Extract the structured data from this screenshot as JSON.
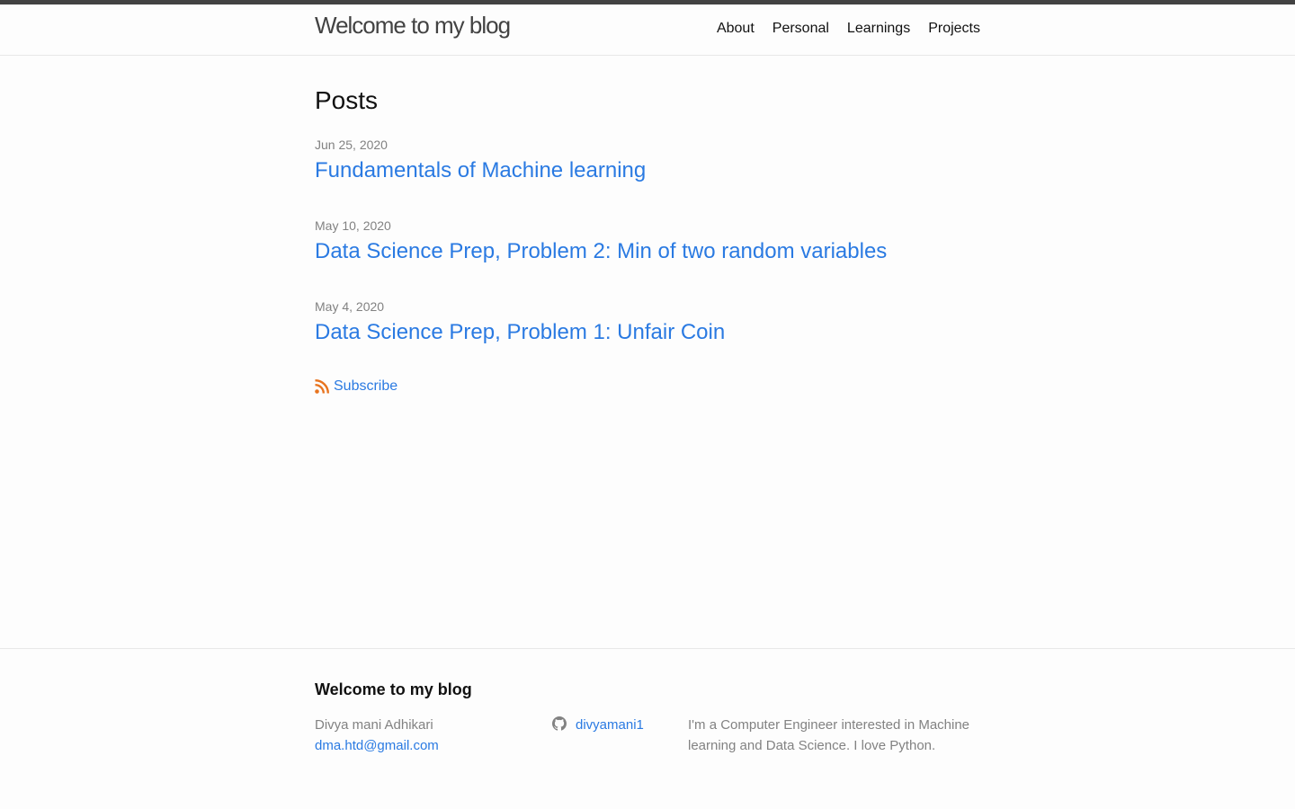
{
  "header": {
    "site_title": "Welcome to my blog",
    "nav": [
      {
        "label": "About"
      },
      {
        "label": "Personal"
      },
      {
        "label": "Learnings"
      },
      {
        "label": "Projects"
      }
    ]
  },
  "main": {
    "heading": "Posts",
    "posts": [
      {
        "date": "Jun 25, 2020",
        "title": "Fundamentals of Machine learning"
      },
      {
        "date": "May 10, 2020",
        "title": "Data Science Prep, Problem 2: Min of two random variables"
      },
      {
        "date": "May 4, 2020",
        "title": "Data Science Prep, Problem 1: Unfair Coin"
      }
    ],
    "subscribe_label": "Subscribe",
    "rss_icon": "rss-icon"
  },
  "footer": {
    "heading": "Welcome to my blog",
    "author_name": "Divya mani Adhikari",
    "email": "dma.htd@gmail.com",
    "github_username": "divyamani1",
    "github_icon": "github-icon",
    "description": "I'm a Computer Engineer interested in Machine learning and Data Science. I love Python."
  },
  "colors": {
    "link": "#2a7ae2",
    "meta": "#828282",
    "text": "#111111",
    "header_bar": "#424242",
    "rss": "#e8741f"
  }
}
